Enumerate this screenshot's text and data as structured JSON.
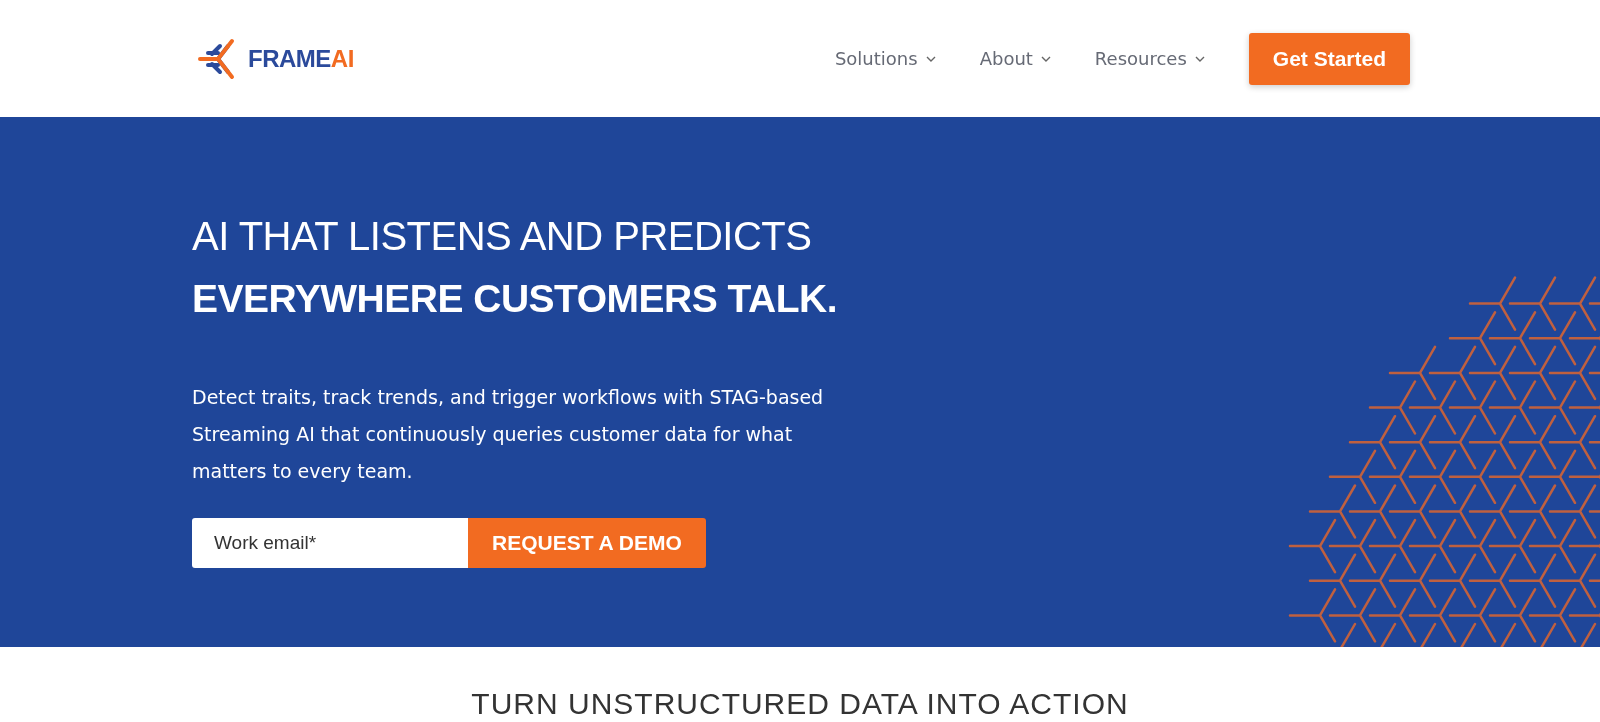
{
  "header": {
    "logo": {
      "word": "FRAME",
      "accent": "AI"
    },
    "nav": [
      {
        "label": "Solutions",
        "has_menu": true
      },
      {
        "label": "About",
        "has_menu": true
      },
      {
        "label": "Resources",
        "has_menu": true
      }
    ],
    "cta": "Get Started"
  },
  "hero": {
    "title_line": "AI THAT LISTENS AND PREDICTS",
    "title_strong": "EVERYWHERE CUSTOMERS TALK.",
    "text": "Detect traits, track trends, and trigger workflows with STAG-based Streaming AI that continuously queries customer data for what matters to every team.",
    "email": {
      "placeholder": "Work email*"
    },
    "button": "REQUEST A DEMO"
  },
  "next_section": {
    "heading": "TURN UNSTRUCTURED DATA INTO ACTION"
  }
}
